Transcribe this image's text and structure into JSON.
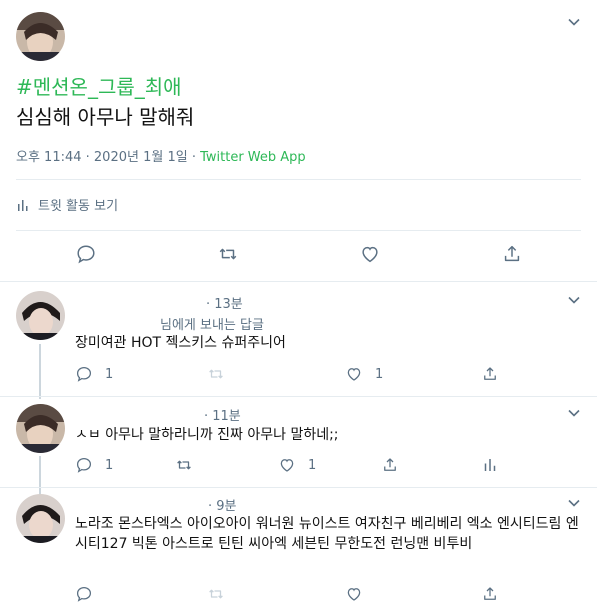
{
  "main_tweet": {
    "hashtag": "#멘션온_그룹_최애",
    "text": "심심해 아무나 말해줘",
    "time": "오후 11:44 · 2020년 1월 1일 ·",
    "app": "Twitter Web App",
    "activity_label": "트윗 활동 보기"
  },
  "replies": [
    {
      "time": "· 13분",
      "to_label": "님에게 보내는 답글",
      "text": "장미여관 HOT 젝스키스 슈퍼주니어",
      "reply_count": "1",
      "like_count": "1"
    },
    {
      "time": "· 11분",
      "text": "ㅅㅂ 아무나 말하라니까 진짜 아무나 말하네;;",
      "reply_count": "1",
      "like_count": "1"
    },
    {
      "time": "· 9분",
      "text": "노라조 몬스타엑스 아이오아이 워너원 뉴이스트 여자친구 베리베리 엑소 엔시티드림 엔시티127 빅톤 아스트로 틴틴 씨아엑 세븐틴 무한도전 런닝맨 비투비"
    }
  ],
  "colors": {
    "accent": "#2eb857",
    "muted": "#5b7083",
    "divider": "#e6ecf0"
  },
  "icons": [
    "chevron-down-icon",
    "reply-icon",
    "retweet-icon",
    "like-icon",
    "share-icon",
    "analytics-icon"
  ]
}
